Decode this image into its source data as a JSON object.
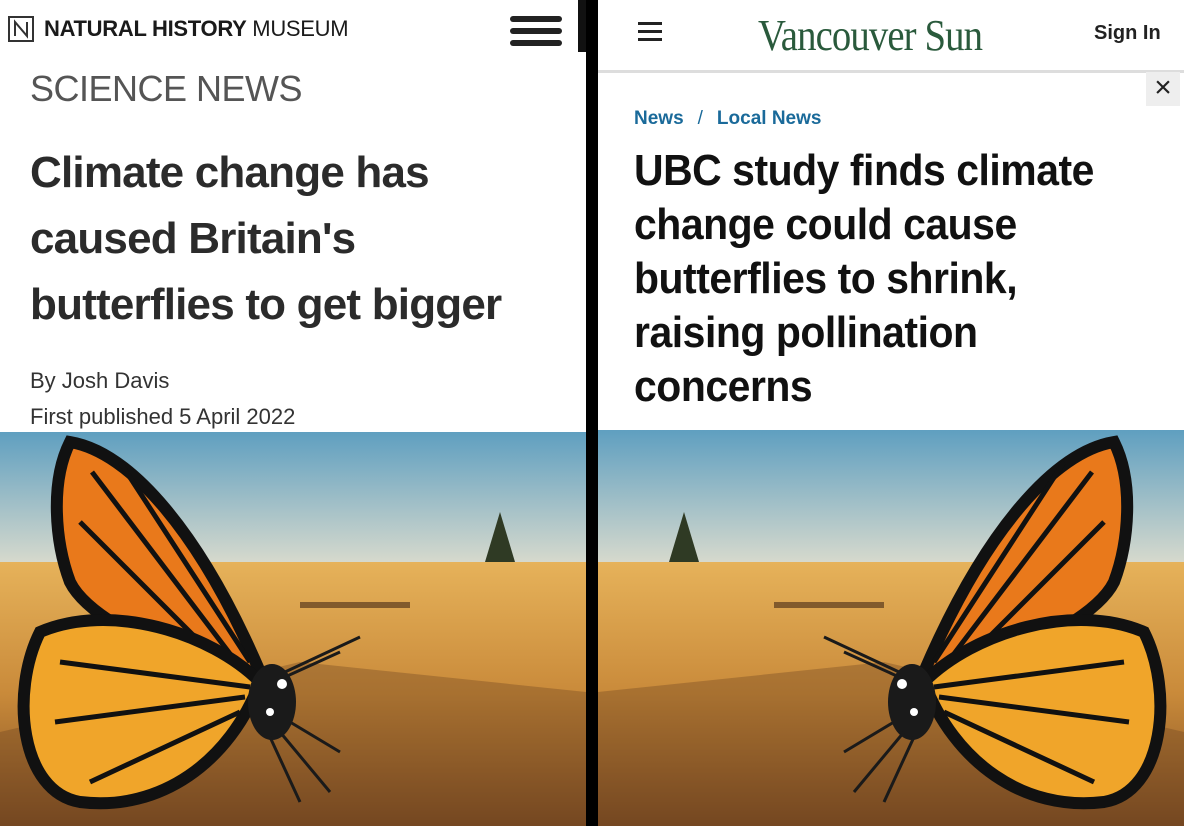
{
  "left_article": {
    "brand_bold": "NATURAL HISTORY",
    "brand_light": "MUSEUM",
    "section": "SCIENCE NEWS",
    "headline": "Climate change has caused Britain's butterflies to get bigger",
    "byline": "By Josh Davis",
    "published": "First published 5 April 2022",
    "logo_icon": "nhm-n-logo-icon",
    "menu_icon": "hamburger-menu-icon"
  },
  "right_article": {
    "logo": "Vancouver Sun",
    "sign_in": "Sign In",
    "close_label": "×",
    "breadcrumb": [
      "News",
      "/",
      "Local News"
    ],
    "headline": "UBC study finds climate change could cause butterflies to shrink, raising pollination concerns",
    "menu_icon": "hamburger-menu-icon",
    "logo_color": "#2a5a3c",
    "link_color": "#1a6a9a"
  }
}
